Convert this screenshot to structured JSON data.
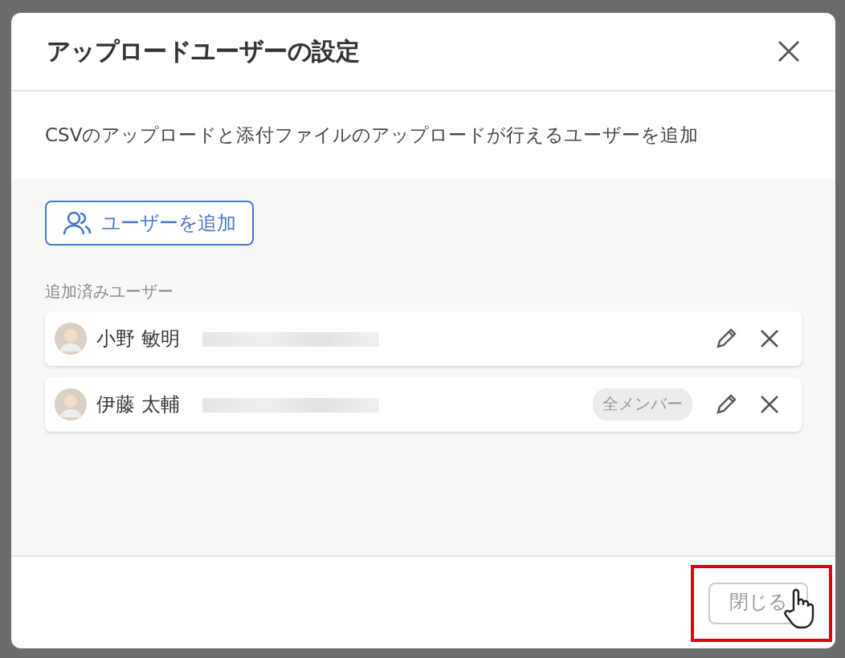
{
  "dialog": {
    "title": "アップロードユーザーの設定",
    "description": "CSVのアップロードと添付ファイルのアップロードが行えるユーザーを追加",
    "add_button": "ユーザーを追加",
    "section_label": "追加済みユーザー",
    "users": [
      {
        "name": "小野 敏明"
      },
      {
        "name": "伊藤 太輔",
        "badge": "全メンバー"
      }
    ],
    "close_button": {
      "label": "閉じる",
      "highlighted": true
    }
  }
}
